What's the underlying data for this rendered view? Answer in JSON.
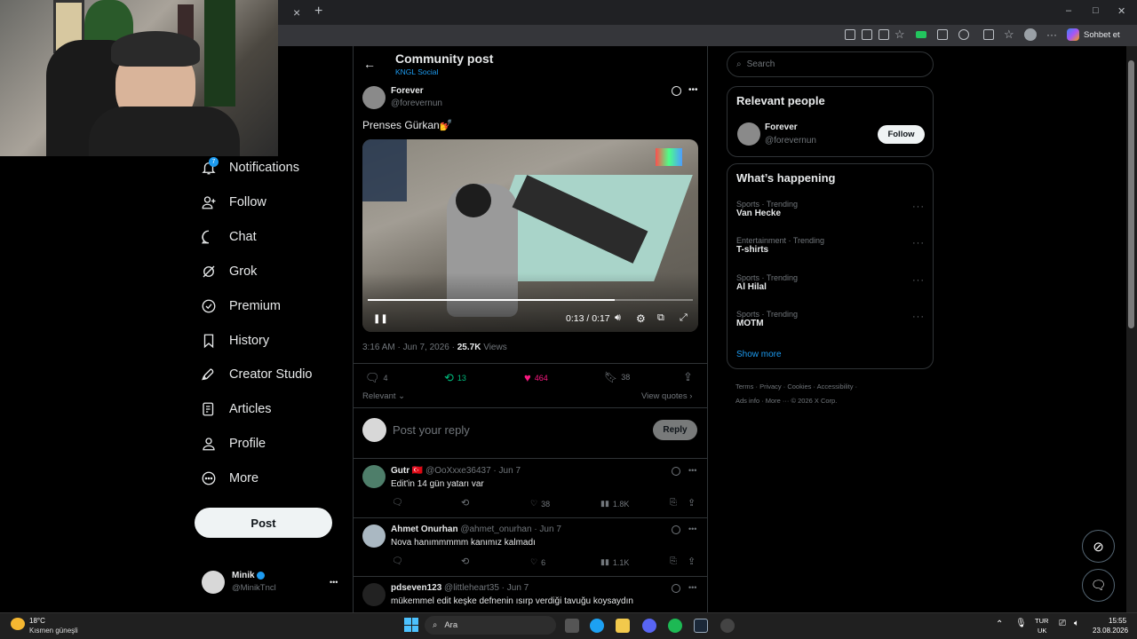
{
  "browser": {
    "close_tab": "×",
    "new_tab": "+",
    "profile_button": "Sohbet et",
    "window_controls": [
      "–",
      "□",
      "✕"
    ]
  },
  "nav": {
    "items": [
      {
        "label": "Notifications",
        "icon": "bell-icon",
        "badge": "7"
      },
      {
        "label": "Follow",
        "icon": "person-add-icon"
      },
      {
        "label": "Chat",
        "icon": "chat-icon"
      },
      {
        "label": "Grok",
        "icon": "grok-icon"
      },
      {
        "label": "Premium",
        "icon": "premium-icon"
      },
      {
        "label": "History",
        "icon": "bookmark-icon"
      },
      {
        "label": "Creator Studio",
        "icon": "rocket-icon"
      },
      {
        "label": "Articles",
        "icon": "article-icon"
      },
      {
        "label": "Profile",
        "icon": "profile-icon"
      },
      {
        "label": "More",
        "icon": "more-circle-icon"
      }
    ],
    "post_button": "Post",
    "account": {
      "name": "Minik",
      "handle": "@MinikTncl",
      "more": "•••"
    }
  },
  "header": {
    "title": "Community post",
    "community": "KNGL Social"
  },
  "post": {
    "author": "Forever",
    "handle": "@forevernun",
    "text": "Prenses Gürkan💅",
    "video": {
      "time": "0:13 / 0:17",
      "progress": 0.76
    },
    "meta_time": "3:16 AM · Jun 7, 2026 · ",
    "views_count": "25.7K",
    "views_label": " Views",
    "stats": {
      "replies": "4",
      "reposts": "13",
      "likes": "464",
      "bookmarks": "38"
    },
    "sort_label": "Relevant",
    "view_quotes": "View quotes"
  },
  "composer": {
    "placeholder": "Post your reply",
    "button": "Reply"
  },
  "replies": [
    {
      "name": "Gutr 🇹🇷",
      "handle": "@OoXxxe36437 · Jun 7",
      "text": "Edit'in 14 gün yatarı var",
      "likes": "38",
      "views": "1.8K"
    },
    {
      "name": "Ahmet Onurhan",
      "handle": "@ahmet_onurhan · Jun 7",
      "text": "Nova hanımmmmm kanımız kalmadı",
      "likes": "6",
      "views": "1.1K"
    },
    {
      "name": "pdseven123",
      "handle": "@littleheart35 · Jun 7",
      "text": "mükemmel edit keşke defnenin ısırp verdiği tavuğu koysaydın",
      "likes": "",
      "views": ""
    }
  ],
  "search": {
    "placeholder": "Search"
  },
  "relevant": {
    "title": "Relevant people",
    "person": {
      "name": "Forever",
      "handle": "@forevernun",
      "button": "Follow"
    }
  },
  "happening": {
    "title": "What’s happening",
    "trends": [
      {
        "category": "Sports · Trending",
        "name": "Van Hecke"
      },
      {
        "category": "Entertainment · Trending",
        "name": "T-shirts"
      },
      {
        "category": "Sports · Trending",
        "name": "Al Hilal"
      },
      {
        "category": "Sports · Trending",
        "name": "MOTM"
      }
    ],
    "show_more": "Show more"
  },
  "footer": {
    "line1": "Terms · Privacy · Cookies · Accessibility ·",
    "line2": "Ads info · More ··· © 2026 X Corp."
  },
  "taskbar": {
    "weather_temp": "18°C",
    "weather_desc": "Kısmen güneşli",
    "search_label": "Ara",
    "lang_top": "TUR",
    "lang_bottom": "UK",
    "time": "15:55",
    "date": "23.08.2026"
  },
  "colors": {
    "accent": "#1d9bf0",
    "like": "#f91880",
    "repost": "#00ba7c"
  }
}
